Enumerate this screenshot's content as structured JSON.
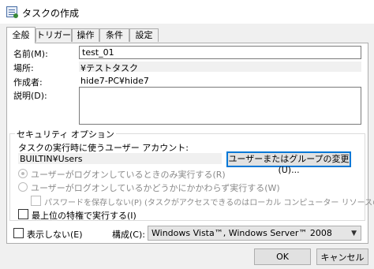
{
  "window": {
    "title": "タスクの作成",
    "icon": "task-scheduler-icon"
  },
  "tabs": [
    {
      "label": "全般",
      "active": true
    },
    {
      "label": "トリガー"
    },
    {
      "label": "操作"
    },
    {
      "label": "条件"
    },
    {
      "label": "設定"
    }
  ],
  "general": {
    "name_label": "名前(M):",
    "name_value": "test_01",
    "location_label": "場所:",
    "location_value": "¥テストタスク",
    "author_label": "作成者:",
    "author_value": "hide7-PC¥hide7",
    "description_label": "説明(D):",
    "description_value": ""
  },
  "security": {
    "group_title": "セキュリティ オプション",
    "account_prompt": "タスクの実行時に使うユーザー アカウント:",
    "account_value": "BUILTIN¥Users",
    "change_button": "ユーザーまたはグループの変更(U)...",
    "radio_logged_on": "ユーザーがログオンしているときのみ実行する(R)",
    "radio_whether": "ユーザーがログオンしているかどうかにかかわらず実行する(W)",
    "chk_no_password": "パスワードを保存しない(P) (タスクがアクセスできるのはローカル コンピューター リソースのみ)",
    "chk_highest": "最上位の特権で実行する(I)"
  },
  "footer": {
    "hidden_label": "表示しない(E)",
    "config_label": "構成(C):",
    "config_value": "Windows Vista™, Windows Server™ 2008",
    "ok": "OK",
    "cancel": "キャンセル"
  }
}
